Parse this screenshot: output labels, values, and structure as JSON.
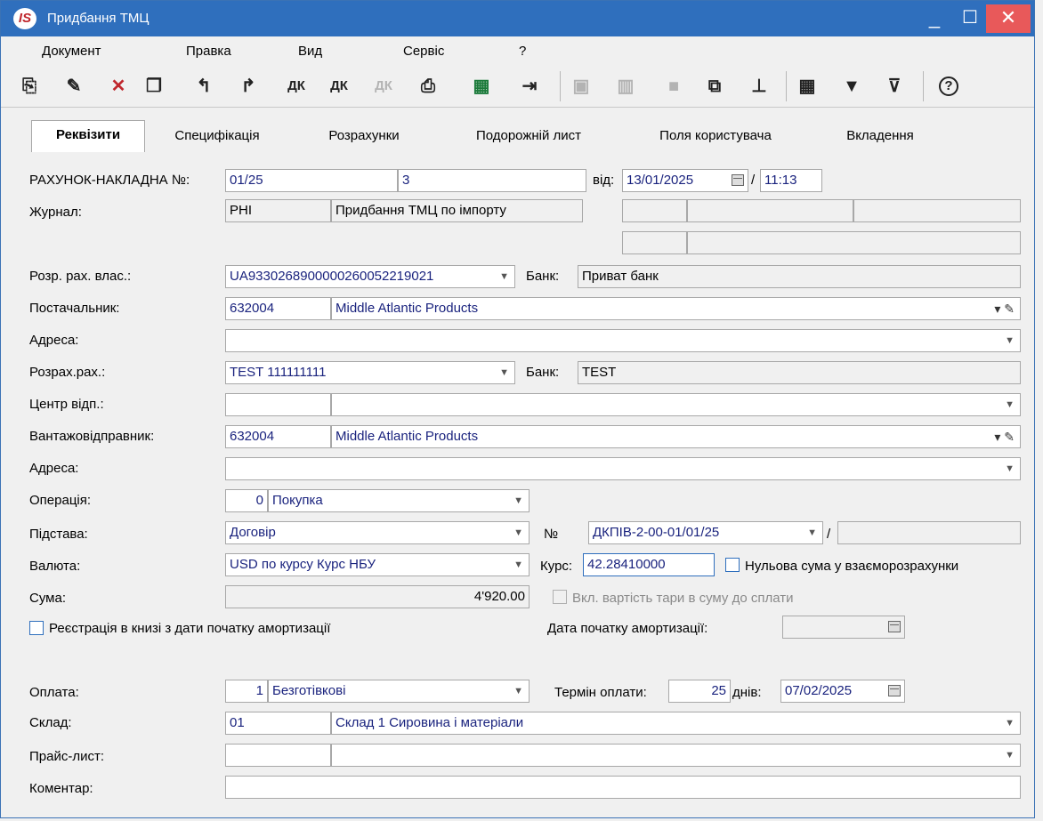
{
  "window": {
    "title": "Придбання ТМЦ",
    "logo_text": "IS",
    "min_label": "_",
    "max_label": "☐",
    "close_label": "✕"
  },
  "menu": [
    "Документ",
    "Правка",
    "Вид",
    "Сервіс",
    "?"
  ],
  "toolbar_icons": [
    "new-doc-icon",
    "edit-doc-icon",
    "delete-doc-icon",
    "copy-doc-icon",
    "prev-doc-icon",
    "next-doc-icon",
    "debit-credit-icon",
    "debit-credit-up-icon",
    "debit-credit-disabled-icon",
    "print-icon",
    "export-excel-icon",
    "exit-icon",
    "save-icon",
    "book-icon",
    "folder-icon",
    "link-icon",
    "tree-icon",
    "grid-icon",
    "filter-icon",
    "clear-filter-icon",
    "help-icon"
  ],
  "tabs": [
    "Реквізити",
    "Специфікація",
    "Розрахунки",
    "Подорожній лист",
    "Поля користувача",
    "Вкладення"
  ],
  "form": {
    "invoice_label": "РАХУНОК-НАКЛАДНА №:",
    "invoice_no": "01/25",
    "invoice_no2": "3",
    "date_label": "від:",
    "date": "13/01/2025",
    "time_sep": "/",
    "time": "11:13",
    "journal_label": "Журнал:",
    "journal_code": "PHI",
    "journal_name": "Придбання ТМЦ по імпорту",
    "own_account_label": "Розр. рах. влас.:",
    "own_account": "UA933026890000026005221902​1",
    "bank_label": "Банк:",
    "own_bank": "Приват банк",
    "supplier_label": "Постачальник:",
    "supplier_code": "632004",
    "supplier_name": "Middle Atlantic Products",
    "address_label": "Адреса:",
    "address": "",
    "settle_account_label": "Розрах.рах.:",
    "settle_account": "TEST 111111111",
    "settle_bank": "TEST",
    "center_label": "Центр відп.:",
    "shipper_label": "Вантажовідправник:",
    "shipper_code": "632004",
    "shipper_name": "Middle Atlantic Products",
    "address2_label": "Адреса:",
    "operation_label": "Операція:",
    "operation_code": "0",
    "operation_name": "Покупка",
    "basis_label": "Підстава:",
    "basis": "Договір",
    "no_label": "№",
    "basis_no": "ДКПІВ-2-00-01/01/25",
    "basis_sep": "/",
    "currency_label": "Валюта:",
    "currency": "USD по курсу Курс НБУ",
    "rate_label": "Курс:",
    "rate": "42.28410000",
    "zero_sum_label": "Нульова сума у взаєморозрахунки",
    "sum_label": "Сума:",
    "sum": "4'920.00",
    "tare_label": "Вкл. вартість тари в суму до сплати",
    "register_label": "Реєстрація в книзі з дати початку амортизації",
    "amort_date_label": "Дата початку амортизації:",
    "payment_label": "Оплата:",
    "payment_code": "1",
    "payment_name": "Безготівкові",
    "term_label": "Термін оплати:",
    "term_days": "25",
    "days_label": "днів:",
    "term_date": "07/02/2025",
    "warehouse_label": "Склад:",
    "warehouse_code": "01",
    "warehouse_name": "Склад 1 Сировина і матеріали",
    "pricelist_label": "Прайс-лист:",
    "comment_label": "Коментар:"
  }
}
